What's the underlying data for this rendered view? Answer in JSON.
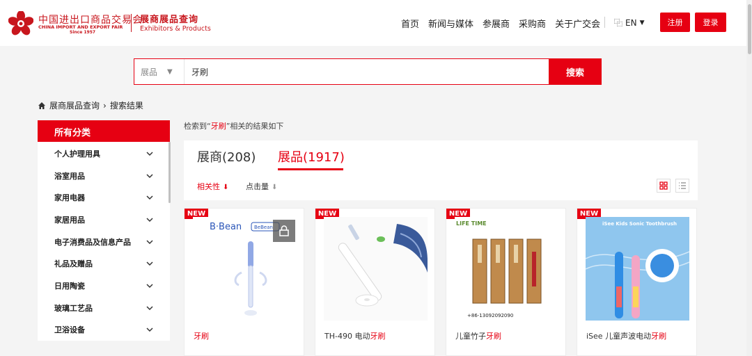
{
  "header": {
    "logo_cn": "中国进出口商品交易会",
    "logo_en": "CHINA IMPORT AND EXPORT FAIR",
    "logo_since": "Since 1957",
    "site_title": "展商展品查询",
    "site_subtitle": "Exhibitors & Products",
    "nav": [
      "首页",
      "新闻与媒体",
      "参展商",
      "采购商",
      "关于广交会"
    ],
    "lang": "EN",
    "register_label": "注册",
    "login_label": "登录"
  },
  "search": {
    "type_label": "展品",
    "query": "牙刷",
    "button_label": "搜索"
  },
  "breadcrumb": {
    "home": "展商展品查询",
    "current": "搜索结果"
  },
  "sidebar": {
    "title": "所有分类",
    "items": [
      {
        "label": "个人护理用具"
      },
      {
        "label": "浴室用品"
      },
      {
        "label": "家用电器"
      },
      {
        "label": "家居用品"
      },
      {
        "label": "电子消费品及信息产品"
      },
      {
        "label": "礼品及赠品"
      },
      {
        "label": "日用陶瓷"
      },
      {
        "label": "玻璃工艺品"
      },
      {
        "label": "卫浴设备"
      }
    ]
  },
  "results": {
    "note_prefix": "检索到“",
    "note_keyword": "牙刷",
    "note_suffix": "”相关的结果如下",
    "tab_exhibitors": "展商(208)",
    "tab_products": "展品(1917)",
    "sort_relevance": "相关性",
    "sort_clicks": "点击量"
  },
  "cards": [
    {
      "badge": "NEW",
      "prefix": "",
      "highlight": "牙刷",
      "brand": "B·Bean",
      "brand2": "BeBean"
    },
    {
      "badge": "NEW",
      "prefix": "TH-490 电动",
      "highlight": "牙刷"
    },
    {
      "badge": "NEW",
      "prefix": "儿童竹子",
      "highlight": "牙刷",
      "brand": "LIFE TIME",
      "phone": "+86-13092092090"
    },
    {
      "badge": "NEW",
      "prefix": "iSee 儿童声波电动",
      "highlight": "牙刷",
      "brand": "iSee Kids Sonic Toothbrush"
    }
  ],
  "colors": {
    "brand_red": "#e60012",
    "logo_red": "#c8161d"
  }
}
